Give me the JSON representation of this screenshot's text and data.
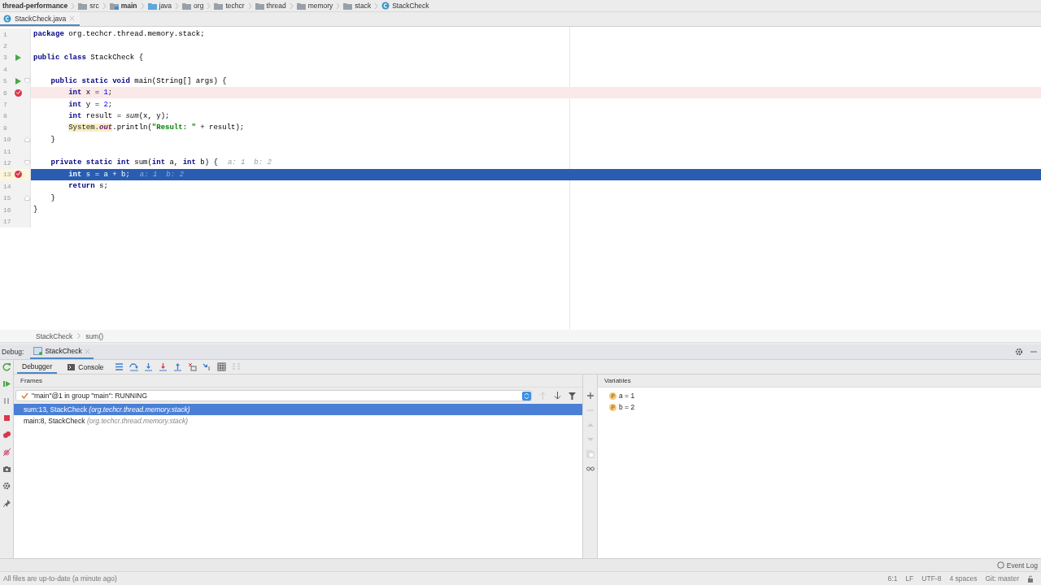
{
  "breadcrumbs": [
    {
      "label": "thread-performance",
      "kind": "project"
    },
    {
      "label": "src",
      "kind": "folder"
    },
    {
      "label": "main",
      "kind": "source_folder"
    },
    {
      "label": "java",
      "kind": "source_root"
    },
    {
      "label": "org",
      "kind": "folder"
    },
    {
      "label": "techcr",
      "kind": "folder"
    },
    {
      "label": "thread",
      "kind": "folder"
    },
    {
      "label": "memory",
      "kind": "folder"
    },
    {
      "label": "stack",
      "kind": "folder"
    },
    {
      "label": "StackCheck",
      "kind": "class"
    }
  ],
  "editor_tabs": [
    {
      "label": "StackCheck.java",
      "selected": true
    }
  ],
  "code_lines": [
    {
      "number": "1",
      "tokens": [
        {
          "text": "package ",
          "kind": "keyword"
        },
        {
          "text": "org.techcr.thread.memory.stack;",
          "kind": "plain"
        }
      ]
    },
    {
      "number": "2"
    },
    {
      "number": "3",
      "runnable": true,
      "tokens": [
        {
          "text": "public class ",
          "kind": "keyword"
        },
        {
          "text": "StackCheck {",
          "kind": "plain"
        }
      ]
    },
    {
      "number": "4"
    },
    {
      "number": "5",
      "runnable": true,
      "fold_start": true,
      "tokens": [
        {
          "text": "    public static void ",
          "kind": "keyword"
        },
        {
          "text": "main(String[] args) {",
          "kind": "plain"
        }
      ]
    },
    {
      "number": "6",
      "breakpoint": true,
      "tokens": [
        {
          "text": "        int ",
          "kind": "keyword"
        },
        {
          "text": "x = ",
          "kind": "plain"
        },
        {
          "text": "1",
          "kind": "number"
        },
        {
          "text": ";",
          "kind": "plain"
        }
      ]
    },
    {
      "number": "7",
      "tokens": [
        {
          "text": "        int ",
          "kind": "keyword"
        },
        {
          "text": "y = ",
          "kind": "plain"
        },
        {
          "text": "2",
          "kind": "number"
        },
        {
          "text": ";",
          "kind": "plain"
        }
      ]
    },
    {
      "number": "8",
      "tokens": [
        {
          "text": "        int ",
          "kind": "keyword"
        },
        {
          "text": "result = ",
          "kind": "plain"
        },
        {
          "text": "sum",
          "kind": "call"
        },
        {
          "text": "(x, y);",
          "kind": "plain"
        }
      ]
    },
    {
      "number": "9",
      "tokens": [
        {
          "text": "        System.",
          "kind": "marked"
        },
        {
          "text": "out",
          "kind": "marked_field"
        },
        {
          "text": ".println(",
          "kind": "plain"
        },
        {
          "text": "\"Result: \"",
          "kind": "string"
        },
        {
          "text": " + result);",
          "kind": "plain"
        }
      ]
    },
    {
      "number": "10",
      "fold_end": true,
      "tokens": [
        {
          "text": "    }",
          "kind": "plain"
        }
      ]
    },
    {
      "number": "11"
    },
    {
      "number": "12",
      "fold_start": true,
      "tokens": [
        {
          "text": "    private static int ",
          "kind": "keyword"
        },
        {
          "text": "sum(",
          "kind": "plain"
        },
        {
          "text": "int ",
          "kind": "keyword"
        },
        {
          "text": "a, ",
          "kind": "plain"
        },
        {
          "text": "int ",
          "kind": "keyword"
        },
        {
          "text": "b) {",
          "kind": "plain"
        },
        {
          "text": "a: 1  b: 2",
          "kind": "hint"
        }
      ]
    },
    {
      "number": "13",
      "breakpoint": true,
      "execution_point": true,
      "tokens": [
        {
          "text": "        int ",
          "kind": "keyword"
        },
        {
          "text": "s = a + b;",
          "kind": "plain"
        },
        {
          "text": "a: 1  b: 2",
          "kind": "hint"
        }
      ]
    },
    {
      "number": "14",
      "tokens": [
        {
          "text": "        return ",
          "kind": "keyword"
        },
        {
          "text": "s;",
          "kind": "plain"
        }
      ]
    },
    {
      "number": "15",
      "fold_end": true,
      "tokens": [
        {
          "text": "    }",
          "kind": "plain"
        }
      ]
    },
    {
      "number": "16",
      "tokens": [
        {
          "text": "}",
          "kind": "plain"
        }
      ]
    },
    {
      "number": "17"
    }
  ],
  "editor_breadcrumbs": [
    "StackCheck",
    "sum()"
  ],
  "debug": {
    "label": "Debug:",
    "session_tabs": [
      {
        "label": "StackCheck",
        "selected": true
      }
    ],
    "tabs": [
      {
        "label": "Debugger",
        "kind": "debugger",
        "selected": true
      },
      {
        "label": "Console",
        "kind": "console",
        "selected": false
      }
    ],
    "frames_title": "Frames",
    "thread": {
      "text": "\"main\"@1 in group \"main\": RUNNING"
    },
    "frames": [
      {
        "location": "sum:13, StackCheck",
        "package": "(org.techcr.thread.memory.stack)",
        "selected": true
      },
      {
        "location": "main:8, StackCheck",
        "package": "(org.techcr.thread.memory.stack)",
        "selected": false
      }
    ],
    "variables_title": "Variables",
    "variables": [
      {
        "text": "a = 1"
      },
      {
        "text": "b = 2"
      }
    ]
  },
  "status_bar": {
    "event_log": "Event Log",
    "message": "All files are up-to-date (a minute ago)",
    "items": [
      "6:1",
      "LF",
      "UTF-8",
      "4 spaces",
      "Git: master"
    ]
  }
}
